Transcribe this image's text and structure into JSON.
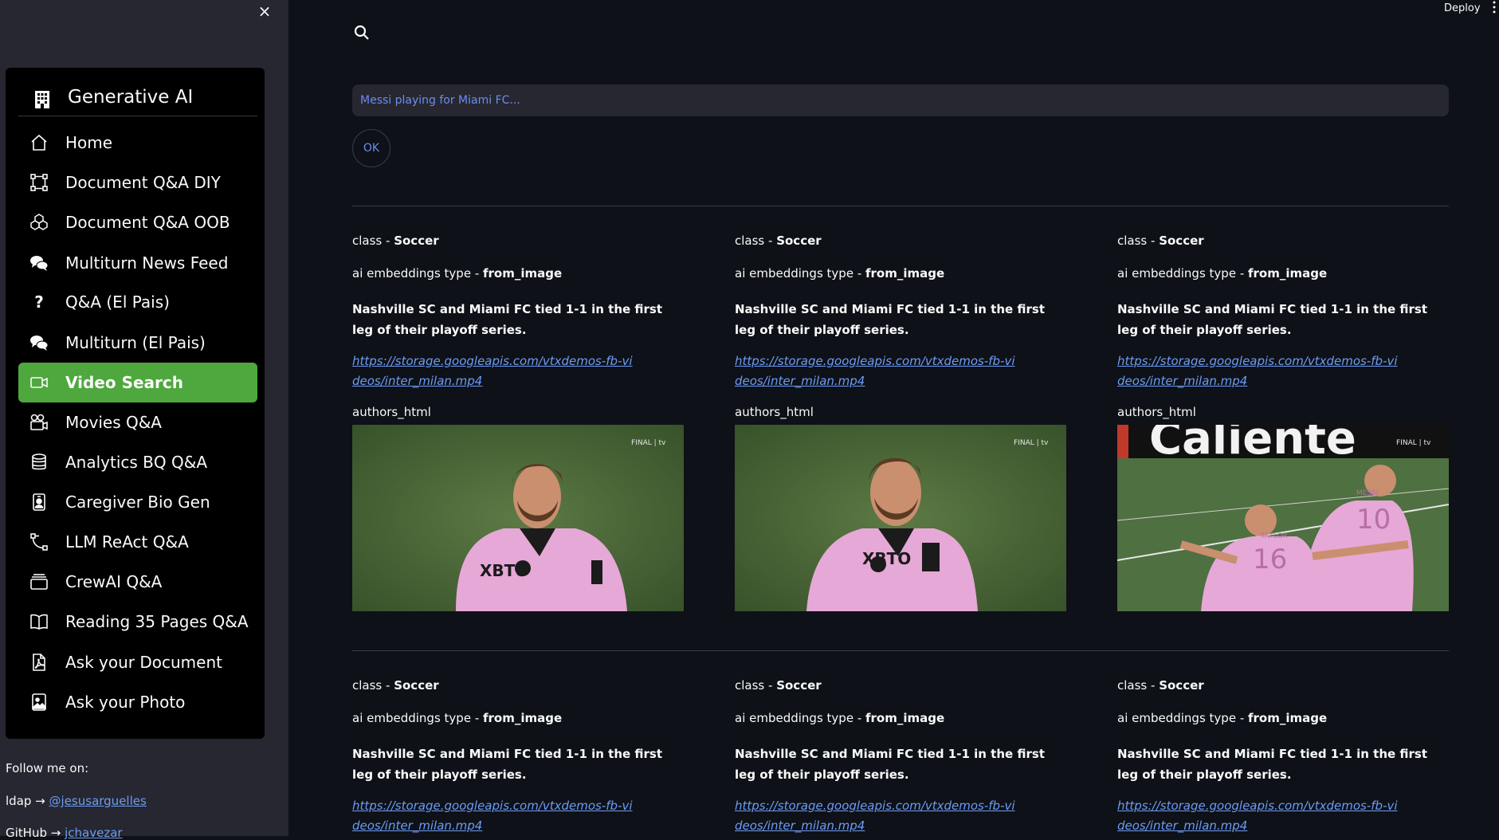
{
  "sidebar": {
    "close_label": "×",
    "menu_title": "Generative AI",
    "items": [
      {
        "label": "Home",
        "icon": "house-icon"
      },
      {
        "label": "Document Q&A DIY",
        "icon": "bounding-box-icon"
      },
      {
        "label": "Document Q&A OOB",
        "icon": "boxes-icon"
      },
      {
        "label": "Multiturn News Feed",
        "icon": "chat-bubbles-icon"
      },
      {
        "label": "Q&A (El Pais)",
        "icon": "question-icon"
      },
      {
        "label": "Multiturn (El Pais)",
        "icon": "chat-bubbles-icon"
      },
      {
        "label": "Video Search",
        "icon": "camera-video-icon",
        "active": true
      },
      {
        "label": "Movies Q&A",
        "icon": "camera-reels-icon"
      },
      {
        "label": "Analytics BQ Q&A",
        "icon": "database-icon"
      },
      {
        "label": "Caregiver Bio Gen",
        "icon": "person-badge-icon"
      },
      {
        "label": "LLM ReAct Q&A",
        "icon": "bezier-icon"
      },
      {
        "label": "CrewAI Q&A",
        "icon": "collection-icon"
      },
      {
        "label": "Reading 35 Pages Q&A",
        "icon": "book-icon"
      },
      {
        "label": "Ask your Document",
        "icon": "file-pdf-icon"
      },
      {
        "label": "Ask your Photo",
        "icon": "file-image-icon"
      }
    ],
    "follow_text": "Follow me on:",
    "ldap_prefix": "ldap →",
    "ldap_link": "@jesusarguelles",
    "github_prefix": "GitHub →",
    "github_link": "jchavezar"
  },
  "header": {
    "deploy_label": "Deploy"
  },
  "search": {
    "placeholder": "Messi playing for Miami FC...",
    "ok_label": "OK"
  },
  "results": [
    {
      "class_prefix": "class - ",
      "class_value": "Soccer",
      "emb_prefix": "ai embeddings type - ",
      "emb_value": "from_image",
      "description": "Nashville SC and Miami FC tied 1-1 in the first leg of their playoff series.",
      "url": "https://storage.googleapis.com/vtxdemos-fb-videos/inter_milan.mp4",
      "authors_label": "authors_html",
      "thumb": "messi-closeup-1"
    },
    {
      "class_prefix": "class - ",
      "class_value": "Soccer",
      "emb_prefix": "ai embeddings type - ",
      "emb_value": "from_image",
      "description": "Nashville SC and Miami FC tied 1-1 in the first leg of their playoff series.",
      "url": "https://storage.googleapis.com/vtxdemos-fb-videos/inter_milan.mp4",
      "authors_label": "authors_html",
      "thumb": "messi-closeup-2"
    },
    {
      "class_prefix": "class - ",
      "class_value": "Soccer",
      "emb_prefix": "ai embeddings type - ",
      "emb_value": "from_image",
      "description": "Nashville SC and Miami FC tied 1-1 in the first leg of their playoff series.",
      "url": "https://storage.googleapis.com/vtxdemos-fb-videos/inter_milan.mp4",
      "authors_label": "authors_html",
      "thumb": "celebration"
    },
    {
      "class_prefix": "class - ",
      "class_value": "Soccer",
      "emb_prefix": "ai embeddings type - ",
      "emb_value": "from_image",
      "description": "Nashville SC and Miami FC tied 1-1 in the first leg of their playoff series.",
      "url": "https://storage.googleapis.com/vtxdemos-fb-videos/inter_milan.mp4"
    },
    {
      "class_prefix": "class - ",
      "class_value": "Soccer",
      "emb_prefix": "ai embeddings type - ",
      "emb_value": "from_image",
      "description": "Nashville SC and Miami FC tied 1-1 in the first leg of their playoff series.",
      "url": "https://storage.googleapis.com/vtxdemos-fb-videos/inter_milan.mp4"
    },
    {
      "class_prefix": "class - ",
      "class_value": "Soccer",
      "emb_prefix": "ai embeddings type - ",
      "emb_value": "from_image",
      "description": "Nashville SC and Miami FC tied 1-1 in the first leg of their playoff series.",
      "url": "https://storage.googleapis.com/vtxdemos-fb-videos/inter_milan.mp4"
    }
  ],
  "thumb_overlay": "FINAL | tv",
  "jersey_numbers": {
    "player_a": "10",
    "player_b": "16"
  },
  "jersey_names": {
    "player_a": "MESSI",
    "player_b": "TAYLOR"
  },
  "sponsor_text": "XBTO",
  "banner_text": "Caliente",
  "colors": {
    "accent_green": "#4ea83d",
    "link": "#6c9cf5",
    "placeholder": "#6c8cf0",
    "pink_kit": "#e6a8d7",
    "pitch": "#4a6b35"
  }
}
